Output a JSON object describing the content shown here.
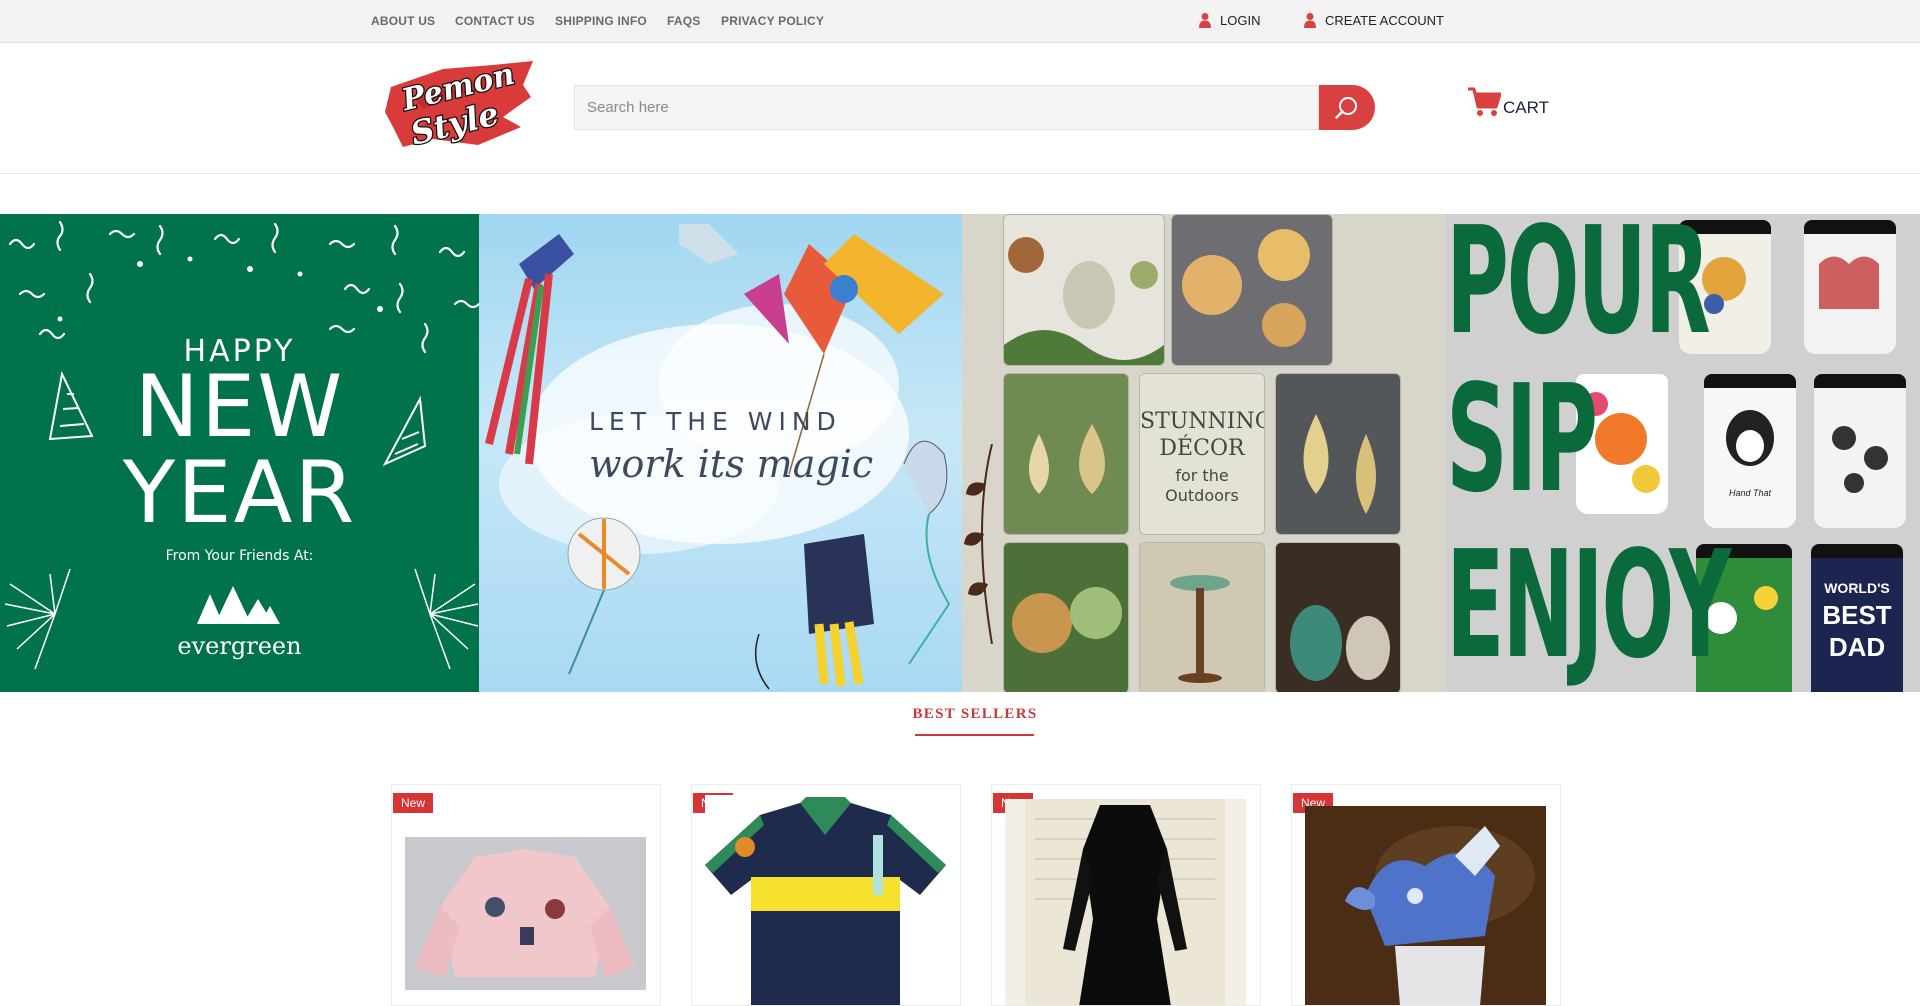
{
  "topbar": {
    "links": [
      "ABOUT US",
      "CONTACT US",
      "SHIPPING INFO",
      "FAQS",
      "PRIVACY POLICY"
    ],
    "login": "LOGIN",
    "create_account": "CREATE ACCOUNT"
  },
  "header": {
    "logo_text_1": "Pemon",
    "logo_text_2": "Style",
    "search_placeholder": "Search here",
    "cart_label": "CART"
  },
  "banner": {
    "new_year": {
      "line1": "HAPPY",
      "line2": "NEW",
      "line3": "YEAR",
      "from": "From Your Friends At:",
      "brand": "evergreen"
    },
    "wind": {
      "line1": "LET THE WIND",
      "line2": "work its magic"
    },
    "decor": {
      "line1": "STUNNING",
      "line2": "DÉCOR",
      "line3": "for the",
      "line4": "Outdoors"
    },
    "pour": {
      "line1": "POUR",
      "line2": "SIP",
      "line3": "ENJOY",
      "mug_text_1": "Hand That",
      "mug_text_2": "WORLD'S",
      "mug_text_3": "BEST",
      "mug_text_4": "DAD"
    }
  },
  "best_sellers": {
    "title": "BEST SELLERS",
    "products": [
      {
        "badge": "New",
        "image": "pink-jacket"
      },
      {
        "badge": "New",
        "image": "polo-shirt"
      },
      {
        "badge": "New",
        "image": "black-dress"
      },
      {
        "badge": "New",
        "image": "glass-figurine"
      }
    ]
  },
  "colors": {
    "accent_red": "#d94141",
    "topbar_bg": "#f2f2f2",
    "green": "#00734a"
  }
}
